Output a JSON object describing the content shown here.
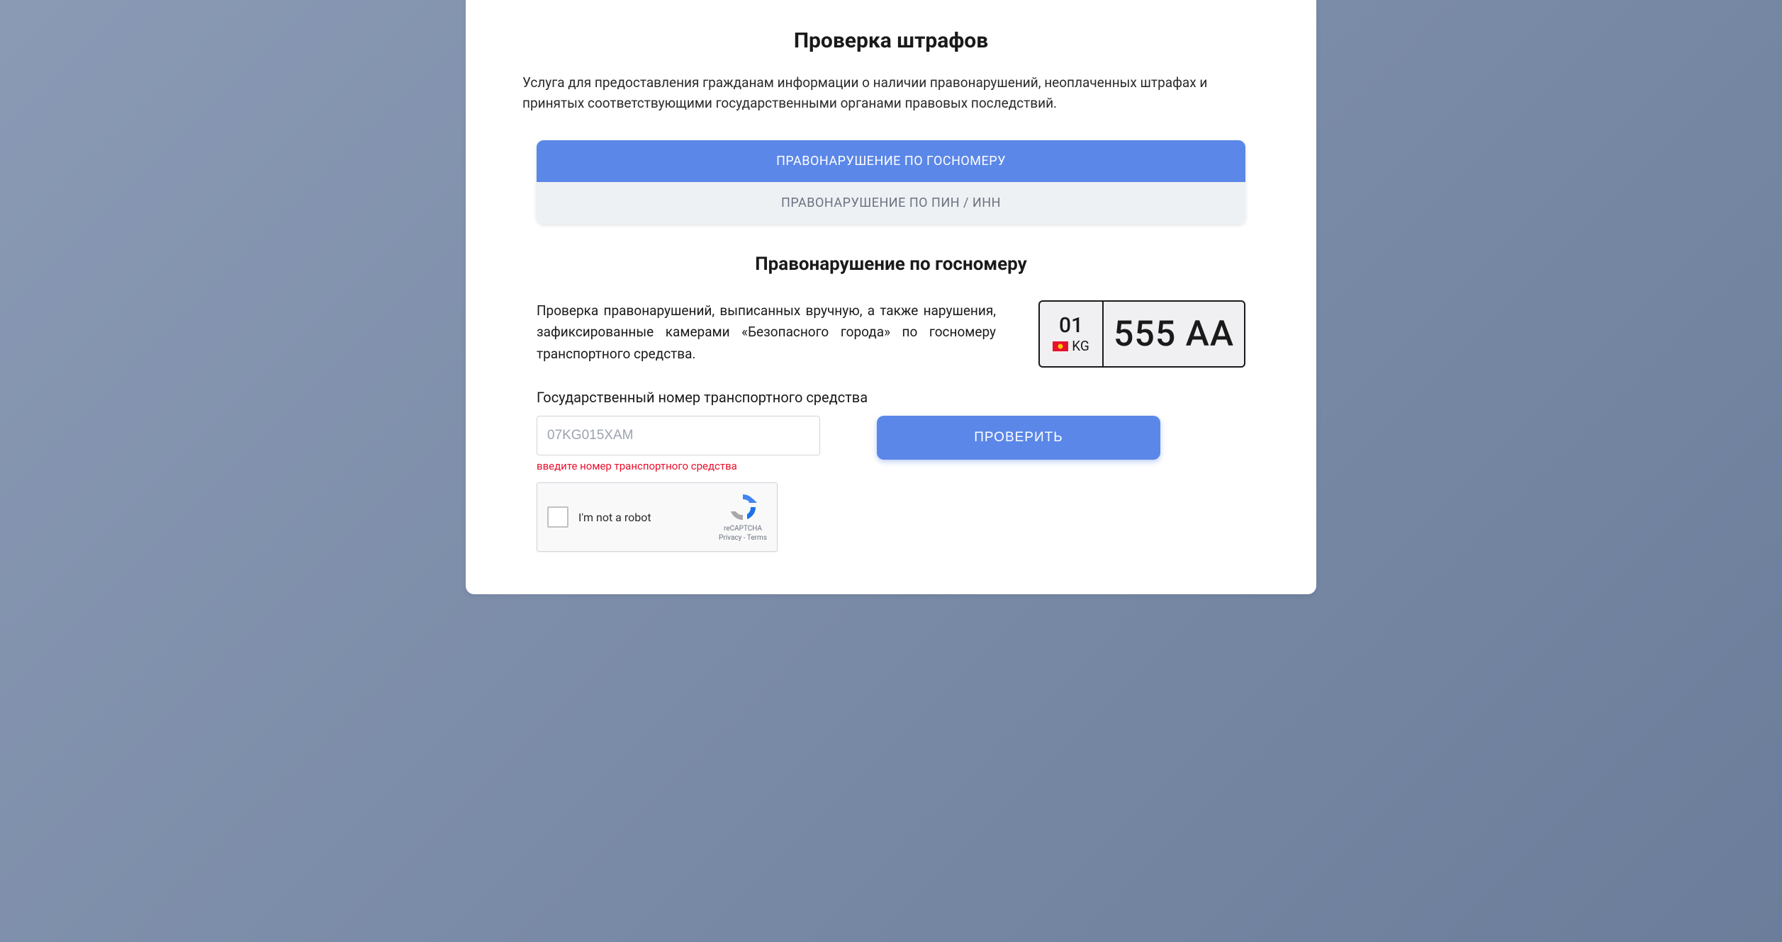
{
  "header": {
    "title": "Проверка штрафов",
    "description": "Услуга для предоставления гражданам информации о наличии правонарушений, неоплаченных штрафах и принятых соответствующими государственными органами правовых последствий."
  },
  "tabs": {
    "active": "ПРАВОНАРУШЕНИЕ ПО ГОСНОМЕРУ",
    "inactive": "ПРАВОНАРУШЕНИЕ ПО ПИН / ИНН"
  },
  "section": {
    "title": "Правонарушение по госномеру",
    "description": "Проверка правонарушений, выписанных вручную, а также нарушения, зафиксированные камерами «Безопасного города» по госномеру транспортного средства."
  },
  "plate": {
    "region_code": "01",
    "country_code": "KG",
    "number": "555 AA"
  },
  "form": {
    "label": "Государственный номер транспортного средства",
    "placeholder": "07KG015XAM",
    "error": "введите номер транспортного средства",
    "submit_label": "ПРОВЕРИТЬ"
  },
  "recaptcha": {
    "label": "I'm not a robot",
    "brand": "reCAPTCHA",
    "links": "Privacy - Terms"
  }
}
